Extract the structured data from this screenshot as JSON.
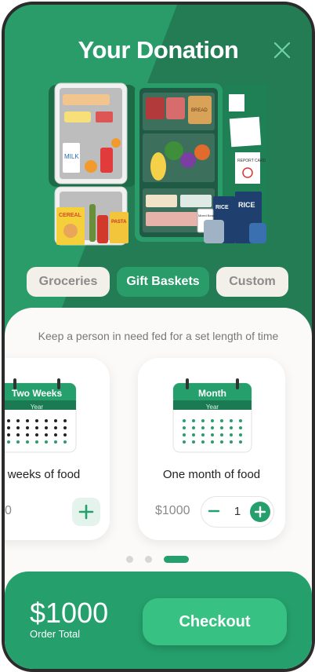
{
  "header": {
    "title": "Your Donation"
  },
  "illustration": {
    "labels": [
      "MILK",
      "CEREAL",
      "PASTA",
      "BREAD",
      "RICE",
      "RICE",
      "REPORT CARD",
      "Mixed Beans"
    ]
  },
  "tabs": [
    {
      "label": "Groceries",
      "active": false
    },
    {
      "label": "Gift Baskets",
      "active": true
    },
    {
      "label": "Custom",
      "active": false
    }
  ],
  "subtitle": "Keep a person in need fed for a set length of time",
  "cards": [
    {
      "calendar_title": "Two Weeks",
      "calendar_sub": "Year",
      "description": "weeks of food",
      "price": "0"
    },
    {
      "calendar_title": "Month",
      "calendar_sub": "Year",
      "description": "One month of food",
      "price": "$1000",
      "quantity": "1"
    }
  ],
  "pagination": {
    "count": 3,
    "active_index": 2
  },
  "footer": {
    "total": "$1000",
    "total_label": "Order Total",
    "checkout_label": "Checkout"
  },
  "colors": {
    "brand_dark": "#237c54",
    "brand_light": "#2a9c69",
    "footer": "#25a06c",
    "checkout": "#37c283"
  }
}
